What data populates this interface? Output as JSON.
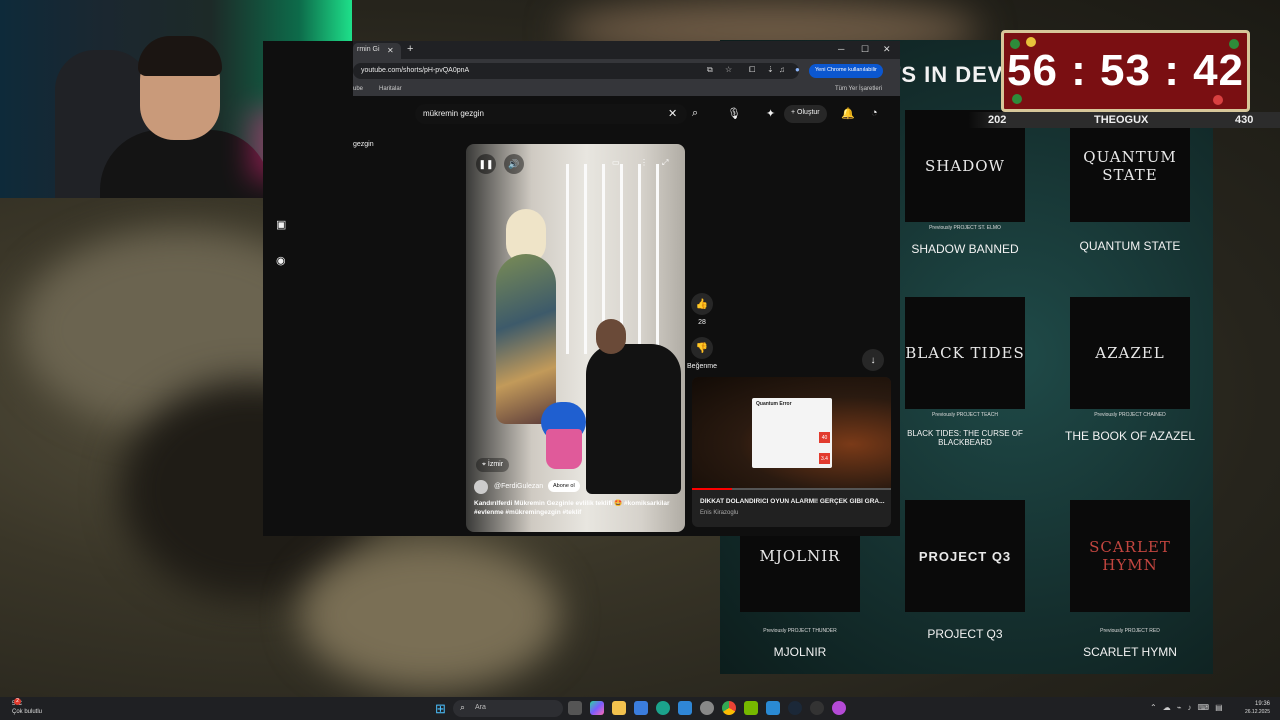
{
  "webcam": {
    "label": "Streamer webcam"
  },
  "roadmap": {
    "title": "CTS IN DEV",
    "games": [
      {
        "thumb": "SHADOW",
        "prev": "Previously PROJECT ST. ELMO",
        "name": "SHADOW BANNED"
      },
      {
        "thumb": "QUANTUM STATE",
        "prev": "",
        "name": "QUANTUM STATE"
      },
      {
        "thumb": "BLACK TIDES",
        "prev": "Previously PROJECT TEACH",
        "name": "BLACK TIDES: THE CURSE OF BLACKBEARD"
      },
      {
        "thumb": "AZAZEL",
        "prev": "Previously PROJECT CHAINED",
        "name": "THE BOOK OF AZAZEL"
      },
      {
        "thumb": "MJOLNIR",
        "prev": "Previously PROJECT THUNDER",
        "name": "MJOLNIR"
      },
      {
        "thumb": "PROJECT Q3",
        "prev": "",
        "name": "PROJECT Q3"
      },
      {
        "thumb": "SCARLET HYMN",
        "prev": "Previously PROJECT RED",
        "name": "SCARLET HYMN"
      }
    ]
  },
  "timer": {
    "value": "56 : 53 : 42"
  },
  "streambar": {
    "left": "202",
    "name": "THEOGUX",
    "right": "430"
  },
  "browser": {
    "tab_title": "rmin Gi",
    "url": "youtube.com/shorts/pH-pvQA0pnA",
    "chrome_pill": "Yeni Chrome kullanılabilir",
    "bookmarks": [
      "ube",
      "Haritalar"
    ],
    "all_bookmarks": "Tüm Yer İşaretleri"
  },
  "youtube": {
    "search_value": "mükremin gezgin",
    "create_label": "Oluştur",
    "sidebar_text": "gezgin",
    "location": "İzmir",
    "channel": "@FerdiGulezan",
    "subscribe": "Abone ol",
    "caption": "Kandırılferdi Mükremin Gezginle evlilik teklifi 🤩 #komiksarkilar #evlenme #mükremingezgin #teklif",
    "likes": "28",
    "dislike_label": "Beğenme",
    "mini": {
      "card_title": "Quantum Error",
      "badge1": "40",
      "badge2": "3.4",
      "title": "DİKKAT DOLANDIRICI OYUN ALARMI! GERÇEK GİBİ GRA...",
      "channel": "Enis Kirazoglu",
      "progress": 0.2
    }
  },
  "taskbar": {
    "weather_temp": "5°C",
    "weather_desc": "Çok bulutlu",
    "weather_badge": "2",
    "search_placeholder": "Ara",
    "time": "19:36",
    "date": "26.12.2025"
  }
}
